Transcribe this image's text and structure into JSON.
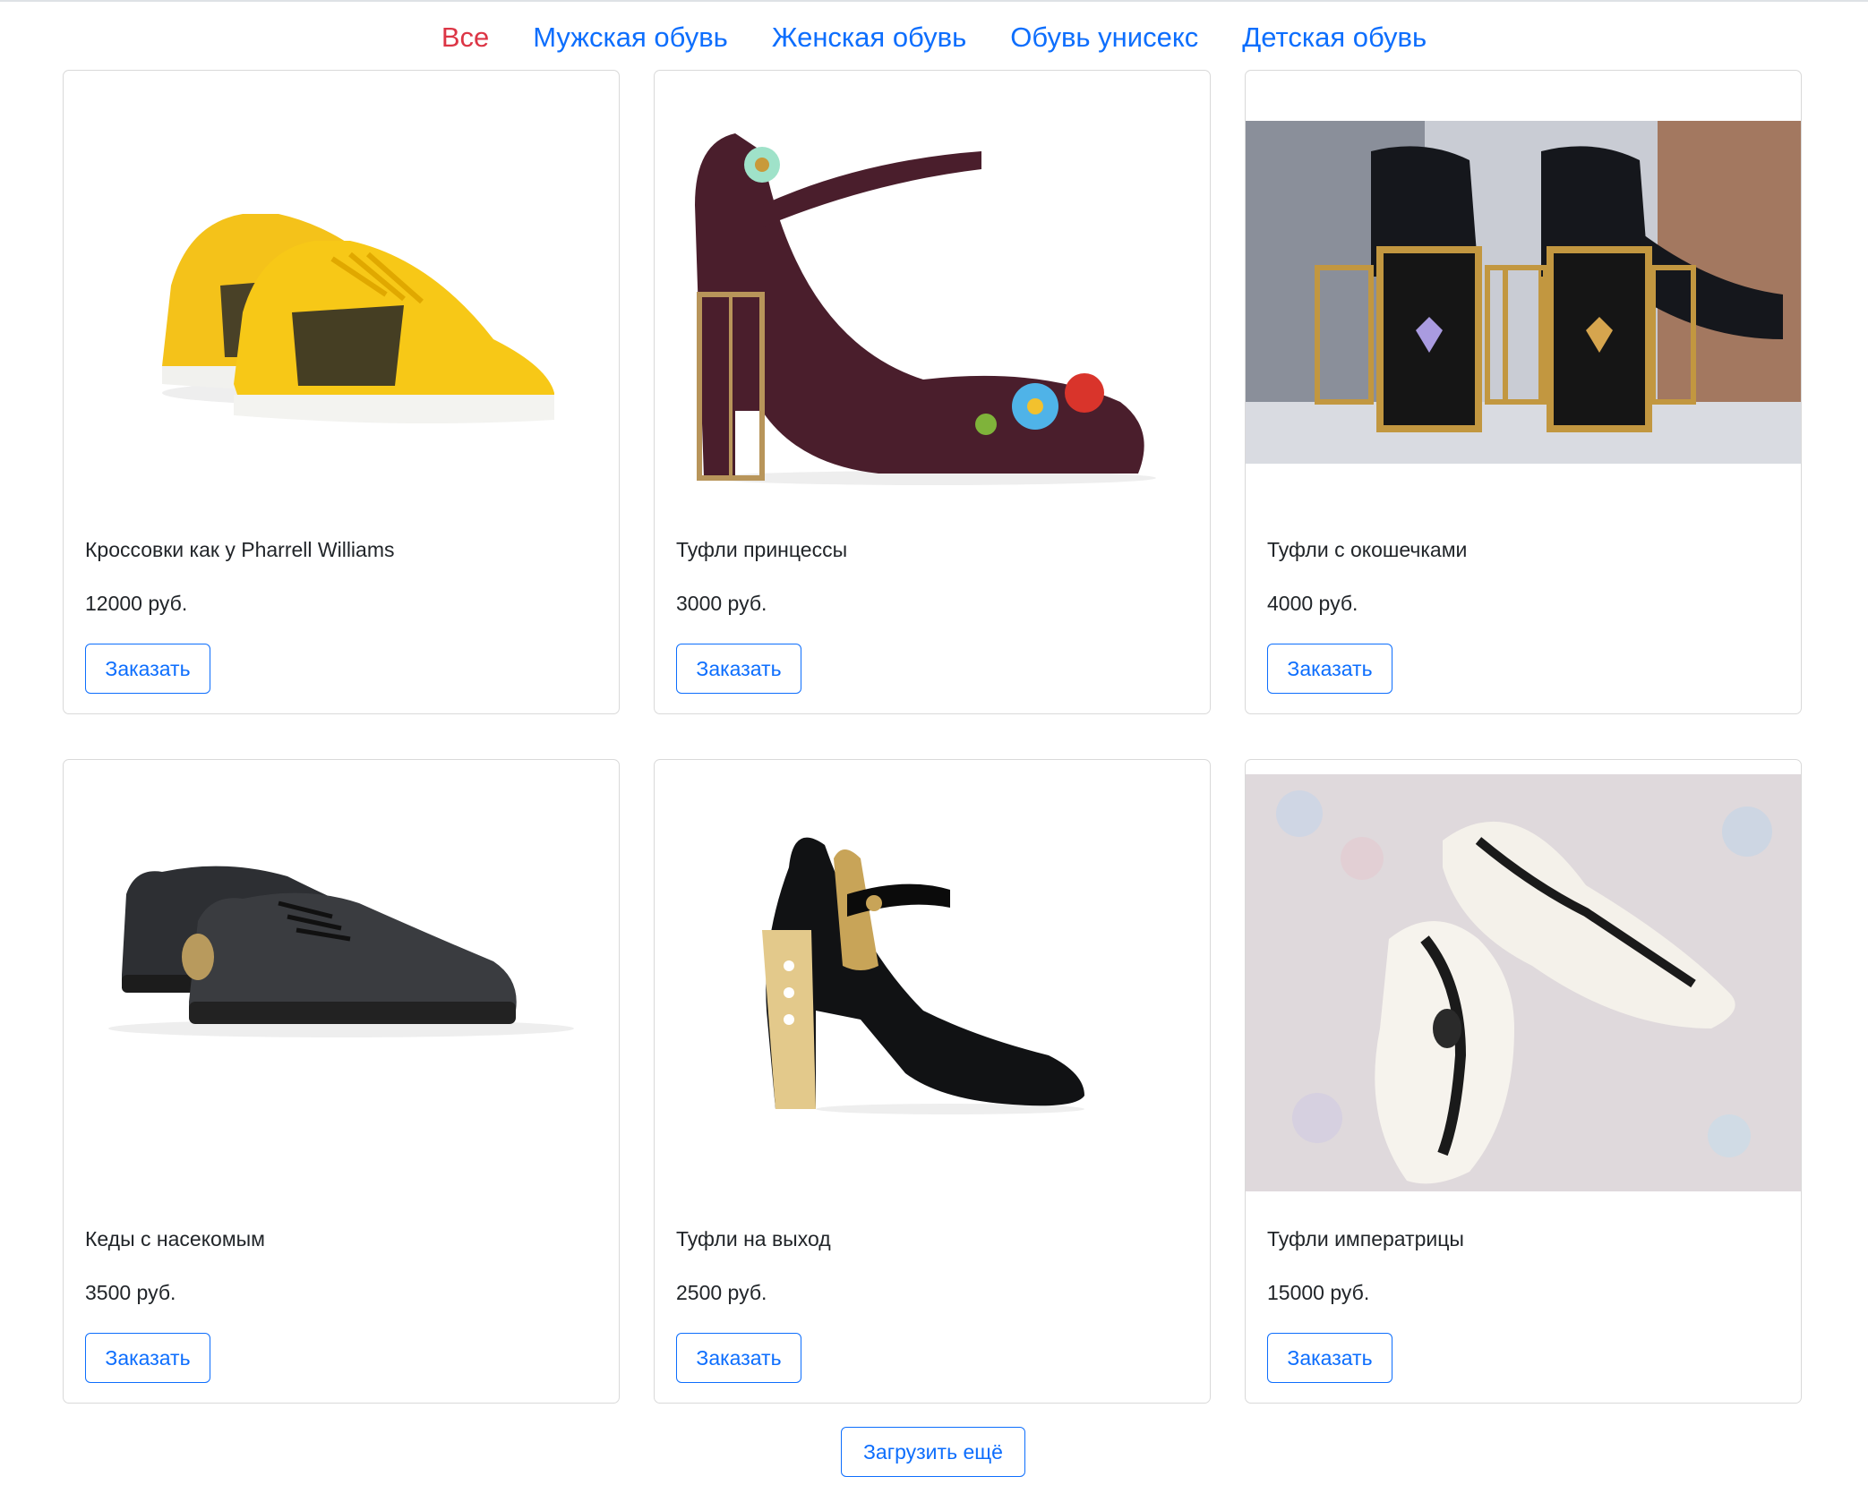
{
  "nav": {
    "items": [
      {
        "label": "Все",
        "active": true
      },
      {
        "label": "Мужская обувь",
        "active": false
      },
      {
        "label": "Женская обувь",
        "active": false
      },
      {
        "label": "Обувь унисекс",
        "active": false
      },
      {
        "label": "Детская обувь",
        "active": false
      }
    ]
  },
  "products": [
    {
      "title": "Кроссовки как у Pharrell Williams",
      "price": "12000 руб.",
      "button": "Заказать",
      "image": "yellow-sneakers-image"
    },
    {
      "title": "Туфли принцессы",
      "price": "3000 руб.",
      "button": "Заказать",
      "image": "velvet-heel-image"
    },
    {
      "title": "Туфли с окошечками",
      "price": "4000 руб.",
      "button": "Заказать",
      "image": "window-heel-shoes-image"
    },
    {
      "title": "Кеды с насекомым",
      "price": "3500 руб.",
      "button": "Заказать",
      "image": "black-sneakers-bee-image"
    },
    {
      "title": "Туфли на выход",
      "price": "2500 руб.",
      "button": "Заказать",
      "image": "patent-mary-jane-image"
    },
    {
      "title": "Туфли императрицы",
      "price": "15000 руб.",
      "button": "Заказать",
      "image": "felt-lace-slippers-image"
    }
  ],
  "load_more": "Загрузить ещё",
  "colors": {
    "link": "#0d6efd",
    "active_link": "#dc3545",
    "card_border": "#d9d9d9"
  }
}
